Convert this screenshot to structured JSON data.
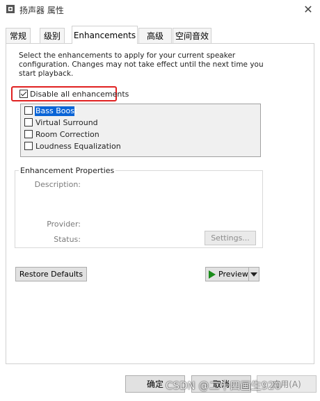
{
  "window": {
    "title": "扬声器 属性",
    "close_glyph": "✕"
  },
  "tabs": [
    {
      "label": "常规"
    },
    {
      "label": "级别"
    },
    {
      "label": "Enhancements"
    },
    {
      "label": "高级"
    },
    {
      "label": "空间音效"
    }
  ],
  "active_tab": "Enhancements",
  "enhancements": {
    "description": "Select the enhancements to apply for your current speaker configuration. Changes may not take effect until the next time you start playback.",
    "disable_all": {
      "label": "Disable all enhancements",
      "checked": true
    },
    "items": [
      {
        "label": "Bass Boost",
        "checked": false,
        "selected": true
      },
      {
        "label": "Virtual Surround",
        "checked": false
      },
      {
        "label": "Room Correction",
        "checked": false
      },
      {
        "label": "Loudness Equalization",
        "checked": false
      }
    ],
    "properties": {
      "title": "Enhancement Properties",
      "description_label": "Description:",
      "provider_label": "Provider:",
      "status_label": "Status:",
      "settings_button": "Settings..."
    },
    "restore_defaults": "Restore Defaults",
    "preview": "Preview"
  },
  "footer": {
    "ok": "确定",
    "cancel": "取消",
    "apply": "应用(A)"
  },
  "watermark": "CSDN @二十四画生920",
  "colors": {
    "highlight_border": "#e02020",
    "selection": "#0a64d6",
    "play_icon": "#1a8c1a"
  }
}
